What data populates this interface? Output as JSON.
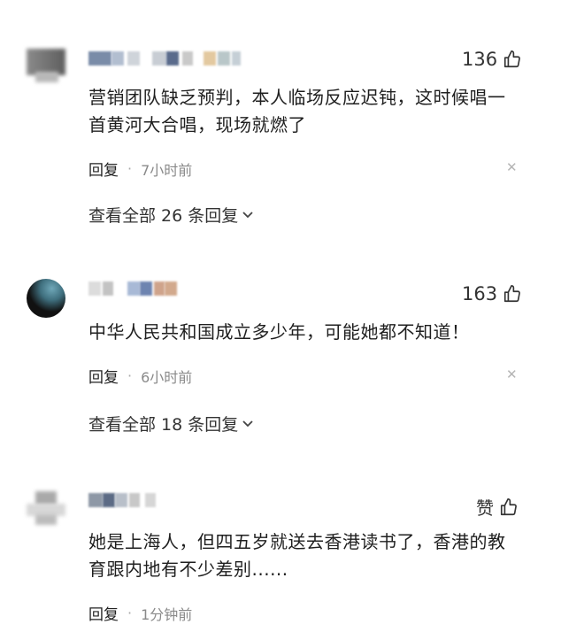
{
  "comments": [
    {
      "likes": "136",
      "text_line1": "营销团队缺乏预判，本人临场反应迟钝，这时候唱一",
      "text_line2": "首黄河大合唱，现场就燃了",
      "reply_label": "回复",
      "time": "7小时前",
      "view_all": "查看全部 26 条回复"
    },
    {
      "likes": "163",
      "text_line1": "中华人民共和国成立多少年，可能她都不知道！",
      "reply_label": "回复",
      "time": "6小时前",
      "view_all": "查看全部 18 条回复"
    },
    {
      "like_label": "赞",
      "text_line1": "她是上海人，但四五岁就送去香港读书了，香港的教",
      "text_line2": "育跟内地有不少差别......",
      "reply_label": "回复",
      "time": "1分钟前"
    }
  ],
  "icons": {
    "thumb": "thumbs-up-icon",
    "close": "close-icon",
    "chevron": "chevron-down-icon"
  }
}
